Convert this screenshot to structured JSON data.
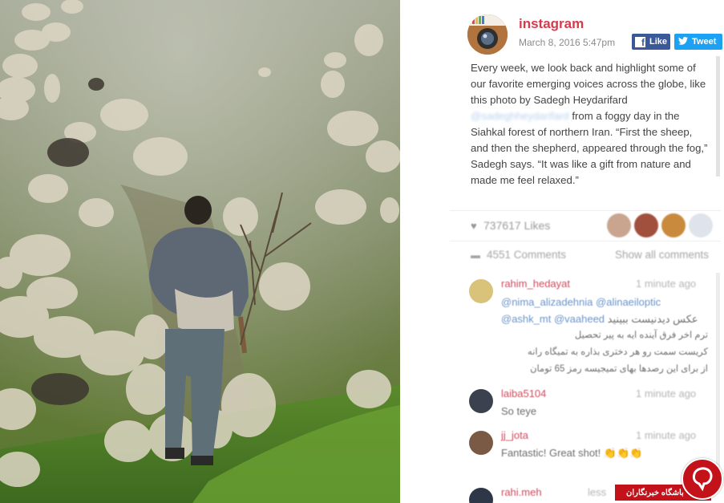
{
  "post": {
    "username": "instagram",
    "timestamp": "March 8, 2016 5:47pm",
    "facebook_label": "Like",
    "twitter_label": "Tweet",
    "caption_before": "Every week, we look back and highlight some of our favorite emerging voices across the globe, like this photo by Sadegh Heydarifard",
    "caption_mention": "@sadeghheydarifard",
    "caption_after": " from a foggy day in the Siahkal forest of northern Iran. “First the sheep, and then the shepherd, appeared through the fog,” Sadegh says. “It was like a gift from nature and made me feel relaxed.”"
  },
  "stats": {
    "likes": "737617 Likes",
    "comments": "4551 Comments",
    "show_all": "Show all comments"
  },
  "comments": [
    {
      "user": "rahim_hedayat",
      "time": "1 minute ago",
      "mentions_line1_a": "@nima_alizadehnia",
      "mentions_line1_b": "@alinaeiloptic",
      "mentions_line2_a": "@ashk_mt",
      "mentions_line2_b": "@vaaheed",
      "mentions_line2_tail": " عکس دیدنیست ببینید",
      "persian_line1": "ترم اخر فرق آینده ایه به پیر تحصیل",
      "persian_line2": "کریست سمت رو هر دختری بذاره به تمیگاه رانه",
      "persian_line3": "از برای این رصدها بهای تمیجیسه رمز 65 تومان"
    },
    {
      "user": "laiba5104",
      "time": "1 minute ago",
      "text": "So teye"
    },
    {
      "user": "jj_jota",
      "time": "1 minute ago",
      "text": "Fantastic! Great shot!",
      "emoji_tail": "👏👏👏"
    },
    {
      "user": "rahi.meh",
      "time": "less"
    }
  ],
  "watermark": {
    "text": "باشگاه خبرنگاران"
  },
  "colors": {
    "username": "#d63a4a",
    "facebook": "#3b5998",
    "twitter": "#1da1f2",
    "watermark": "#c3121a"
  },
  "icons": [
    "instagram-logo-icon",
    "facebook-icon",
    "twitter-bird-icon",
    "heart-icon",
    "comment-bubble-icon"
  ]
}
